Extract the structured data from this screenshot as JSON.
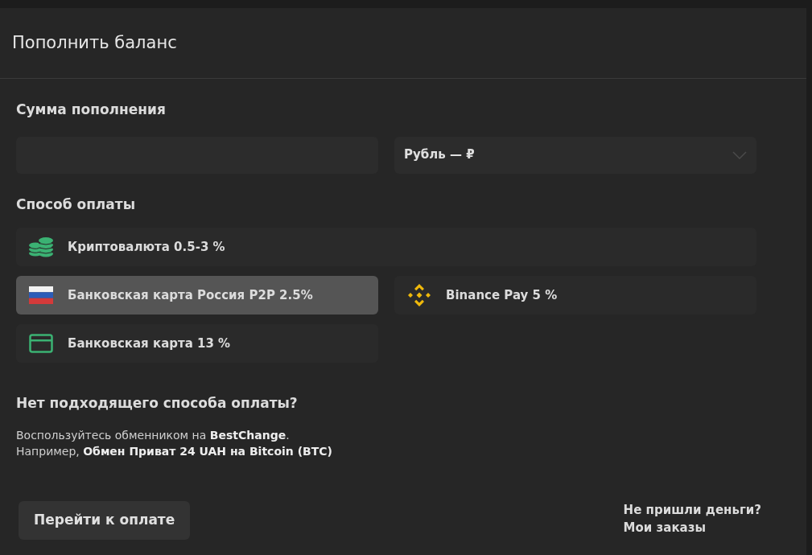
{
  "title": "Пополнить баланс",
  "amount": {
    "label": "Сумма пополнения",
    "currency": "Рубль — ₽"
  },
  "payment": {
    "label": "Способ оплаты",
    "methods": [
      {
        "kind": "coins",
        "label": "Криптовалюта 0.5-3 %",
        "wide": true,
        "selected": false
      },
      {
        "kind": "flag",
        "label": "Банковская карта Россия P2P 2.5%",
        "wide": false,
        "selected": true
      },
      {
        "kind": "binance",
        "label": "Binance Pay 5 %",
        "wide": false,
        "selected": false
      },
      {
        "kind": "card",
        "label": "Банковская карта 13 %",
        "wide": false,
        "selected": false
      }
    ]
  },
  "help": {
    "heading": "Нет подходящего способа оплаты?",
    "lines": [
      "Воспользуйтесь обменником на **BestChange**.",
      "Например, **Обмен Приват 24 UAH на Bitcoin (BTC)**"
    ]
  },
  "submit": "Перейти к оплате",
  "links": [
    "Не пришли деньги?",
    "Мои заказы"
  ]
}
